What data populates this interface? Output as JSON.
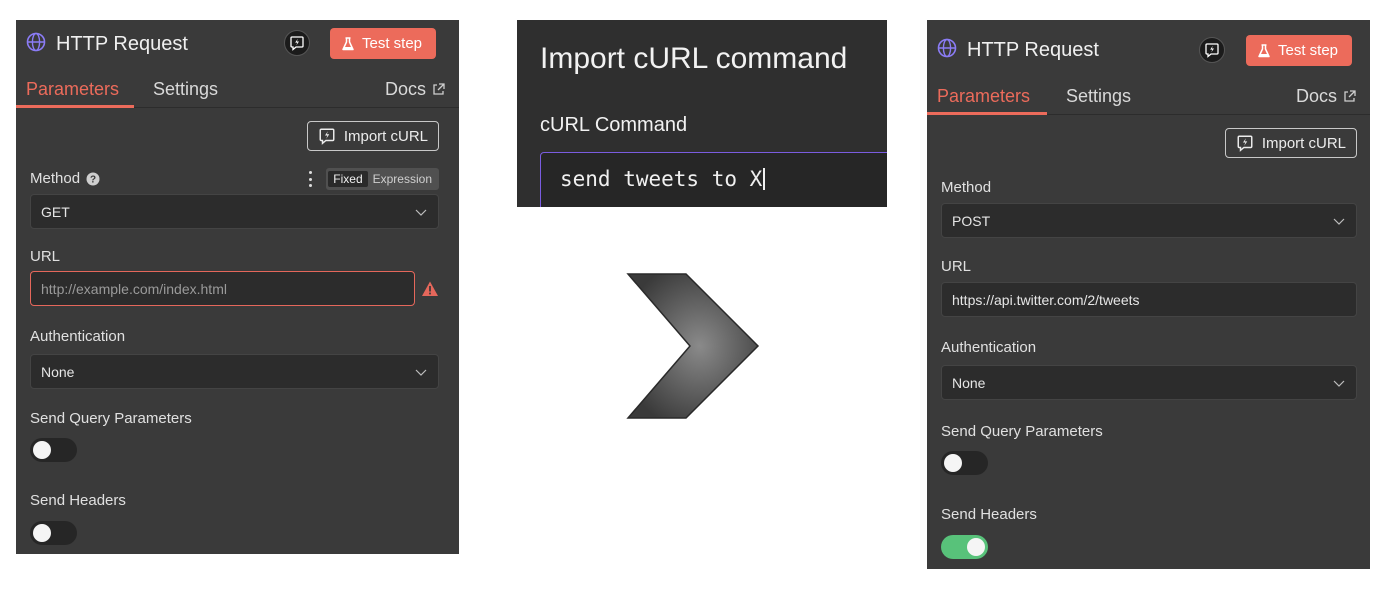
{
  "left": {
    "title": "HTTP Request",
    "test_step": "Test step",
    "tabs": {
      "parameters": "Parameters",
      "settings": "Settings",
      "docs": "Docs"
    },
    "import_curl": "Import cURL",
    "method": {
      "label": "Method",
      "mode_fixed": "Fixed",
      "mode_expression": "Expression",
      "value": "GET"
    },
    "url": {
      "label": "URL",
      "placeholder": "http://example.com/index.html"
    },
    "authentication": {
      "label": "Authentication",
      "value": "None"
    },
    "send_query": {
      "label": "Send Query Parameters",
      "enabled": false
    },
    "send_headers": {
      "label": "Send Headers",
      "enabled": false
    }
  },
  "modal": {
    "title": "Import cURL command",
    "label": "cURL Command",
    "value": "send tweets to X"
  },
  "right": {
    "title": "HTTP Request",
    "test_step": "Test step",
    "tabs": {
      "parameters": "Parameters",
      "settings": "Settings",
      "docs": "Docs"
    },
    "import_curl": "Import cURL",
    "method": {
      "label": "Method",
      "value": "POST"
    },
    "url": {
      "label": "URL",
      "value": "https://api.twitter.com/2/tweets"
    },
    "authentication": {
      "label": "Authentication",
      "value": "None"
    },
    "send_query": {
      "label": "Send Query Parameters",
      "enabled": false
    },
    "send_headers": {
      "label": "Send Headers",
      "enabled": true
    }
  },
  "colors": {
    "accent": "#ec6b5b",
    "toggle_on": "#58c27a",
    "focus": "#7a5ce0",
    "globe": "#8b7cf6"
  }
}
